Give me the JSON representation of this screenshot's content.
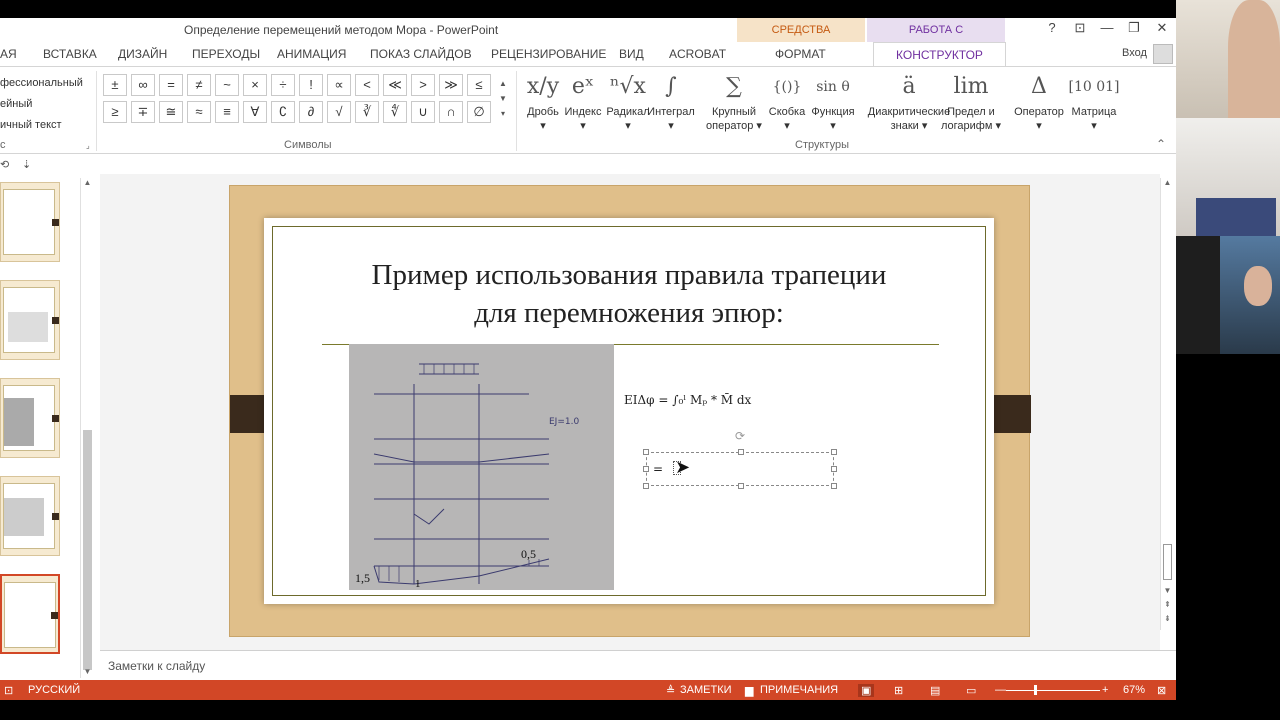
{
  "window": {
    "title": "Определение перемещений методом Мора - PowerPoint",
    "context_tab_drawing": "СРЕДСТВА РИСОВАНИЯ",
    "context_tab_equations": "РАБОТА С УРАВНЕНИЯМИ",
    "help": "?",
    "ribbon_display": "⊡",
    "minimize": "—",
    "restore": "❐",
    "close": "✕"
  },
  "tabs": [
    "АЯ",
    "ВСТАВКА",
    "ДИЗАЙН",
    "ПЕРЕХОДЫ",
    "АНИМАЦИЯ",
    "ПОКАЗ СЛАЙДОВ",
    "РЕЦЕНЗИРОВАНИЕ",
    "ВИД",
    "ACROBAT",
    "ФОРМАТ",
    "КОНСТРУКТОР"
  ],
  "signin": "Вход",
  "ribbon": {
    "tools": [
      "фессиональный",
      "ейный",
      "ичный текст"
    ],
    "tools_label": "с",
    "symbols_label": "Символы",
    "symbols_row1": [
      "±",
      "∞",
      "=",
      "≠",
      "~",
      "×",
      "÷",
      "!",
      "∝",
      "<",
      "≪",
      ">",
      "≫",
      "≤"
    ],
    "symbols_row2": [
      "≥",
      "∓",
      "≅",
      "≈",
      "≡",
      "∀",
      "∁",
      "∂",
      "√",
      "∛",
      "∜",
      "∪",
      "∩",
      "∅"
    ],
    "structures_label": "Структуры",
    "structures": [
      {
        "glyph": "x/y",
        "label": "Дробь",
        "label2": "▾"
      },
      {
        "glyph": "eˣ",
        "label": "Индекс",
        "label2": "▾"
      },
      {
        "glyph": "ⁿ√x",
        "label": "Радикал",
        "label2": "▾"
      },
      {
        "glyph": "∫",
        "label": "Интеграл",
        "label2": "▾"
      },
      {
        "glyph": "∑",
        "label": "Крупный",
        "label2": "оператор ▾"
      },
      {
        "glyph": "{()}",
        "label": "Скобка",
        "label2": "▾"
      },
      {
        "glyph": "sin θ",
        "label": "Функция",
        "label2": "▾"
      },
      {
        "glyph": "ä",
        "label": "Диакритические",
        "label2": "знаки ▾"
      },
      {
        "glyph": "lim",
        "label": "Предел и",
        "label2": "логарифм ▾"
      },
      {
        "glyph": "Δ",
        "label": "Оператор",
        "label2": "▾"
      },
      {
        "glyph": "[10 01]",
        "label": "Матрица",
        "label2": "▾"
      }
    ]
  },
  "slide": {
    "title_line1": "Пример использования правила трапеции",
    "title_line2": "для перемножения эпюр:",
    "equation": "EIΔφ = ∫₀ˡ Mₚ * M̄ dx",
    "equation_eq_sign": "=",
    "photo_label_left": "1,5",
    "photo_label_right": "0,5",
    "photo_label_bottom": "1"
  },
  "notes": {
    "placeholder": "Заметки к слайду"
  },
  "status": {
    "language": "РУССКИЙ",
    "notes": "ЗАМЕТКИ",
    "comments": "ПРИМЕЧАНИЯ",
    "zoom": "67%"
  },
  "colors": {
    "accent": "#d24726",
    "equations_tab": "#7030a0",
    "drawing_tab": "#c55a11"
  }
}
